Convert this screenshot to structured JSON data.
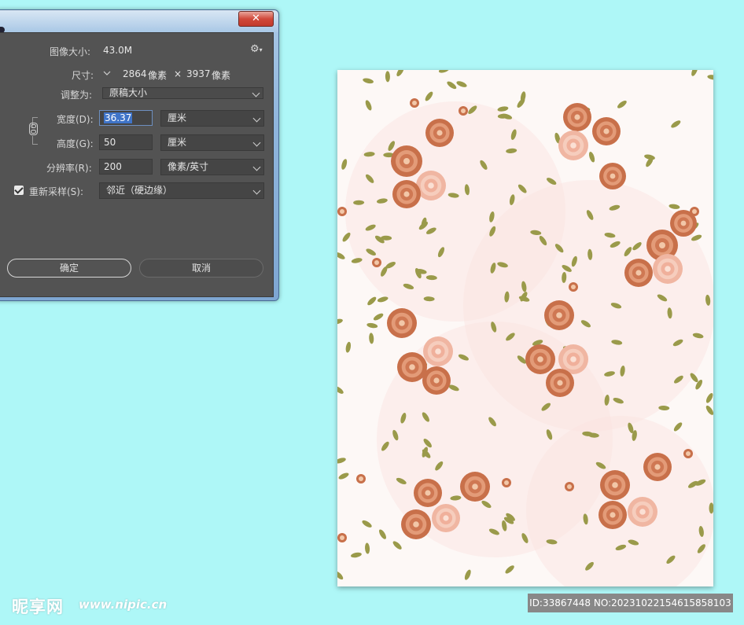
{
  "window": {
    "close_label": "✕"
  },
  "dialog": {
    "image_size": {
      "label": "图像大小:",
      "value": "43.0M"
    },
    "dimensions": {
      "label": "尺寸:",
      "width_px": "2864",
      "unit1": "像素",
      "times": "×",
      "height_px": "3937",
      "unit2": "像素"
    },
    "fit_to": {
      "label": "调整为:",
      "value": "原稿大小"
    },
    "width": {
      "label": "宽度(D):",
      "value": "36.37",
      "unit": "厘米"
    },
    "height": {
      "label": "高度(G):",
      "value": "50",
      "unit": "厘米"
    },
    "resolution": {
      "label": "分辨率(R):",
      "value": "200",
      "unit": "像素/英寸"
    },
    "resample": {
      "label": "重新采样(S):",
      "checked": true,
      "value": "邻近（硬边缘）"
    },
    "ok_label": "确定",
    "cancel_label": "取消"
  },
  "watermark": {
    "logo": "昵享网",
    "url": "www.nipic.cn",
    "id_text": "ID:33867448 NO:20231022154615858103"
  },
  "colors": {
    "desktop": "#aef7f7",
    "dialog_bg": "#535353",
    "field_bg": "#454545",
    "selection": "#3f74c8",
    "rose": "#c8704a",
    "rose_light": "#f0b6a2",
    "leaf": "#9a9a4a"
  }
}
